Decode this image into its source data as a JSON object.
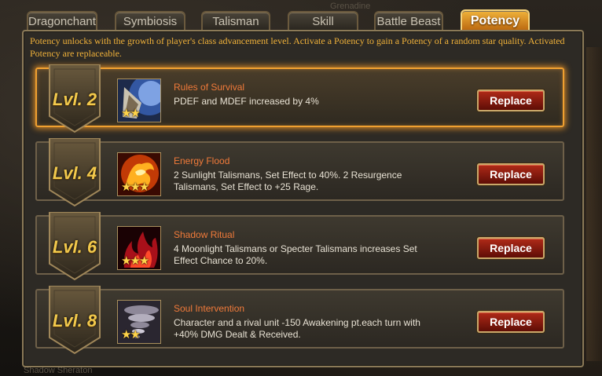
{
  "tabs": [
    {
      "label": "Dragonchant",
      "active": false
    },
    {
      "label": "Symbiosis",
      "active": false
    },
    {
      "label": "Talisman",
      "active": false
    },
    {
      "label": "Skill",
      "active": false
    },
    {
      "label": "Battle Beast",
      "active": false
    },
    {
      "label": "Potency",
      "active": true
    }
  ],
  "background_text": {
    "top": "Grenadine",
    "bottom": "Shadow Sheraton"
  },
  "intro": "Potency unlocks with the growth of player's class advancement level. Activate a Potency to gain a Potency of a random star quality. Activated Potency are replaceable.",
  "potencies": [
    {
      "level": "Lvl. 2",
      "name": "Rules of Survival",
      "description": "PDEF and MDEF increased by 4%",
      "stars": 2,
      "icon": "shield-knight-icon",
      "button": "Replace",
      "highlighted": true
    },
    {
      "level": "Lvl. 4",
      "name": "Energy Flood",
      "description": "2 Sunlight Talismans, Set Effect to 40%. 2 Resurgence Talismans, Set Effect to +25 Rage.",
      "stars": 3,
      "icon": "fire-dragon-icon",
      "button": "Replace",
      "highlighted": false
    },
    {
      "level": "Lvl. 6",
      "name": "Shadow Ritual",
      "description": "4 Moonlight Talismans or Specter Talismans increases Set Effect Chance to 20%.",
      "stars": 3,
      "icon": "dark-flame-icon",
      "button": "Replace",
      "highlighted": false
    },
    {
      "level": "Lvl. 8",
      "name": "Soul Intervention",
      "description": "Character and a rival unit -150 Awakening pt.each turn with +40% DMG Dealt & Received.",
      "stars": 2,
      "icon": "whirlwind-icon",
      "button": "Replace",
      "highlighted": false
    }
  ],
  "colors": {
    "accent": "#f1b23a",
    "skill_name": "#f07a3a",
    "button_red": "#b02a18",
    "star": "#ffd44a"
  }
}
